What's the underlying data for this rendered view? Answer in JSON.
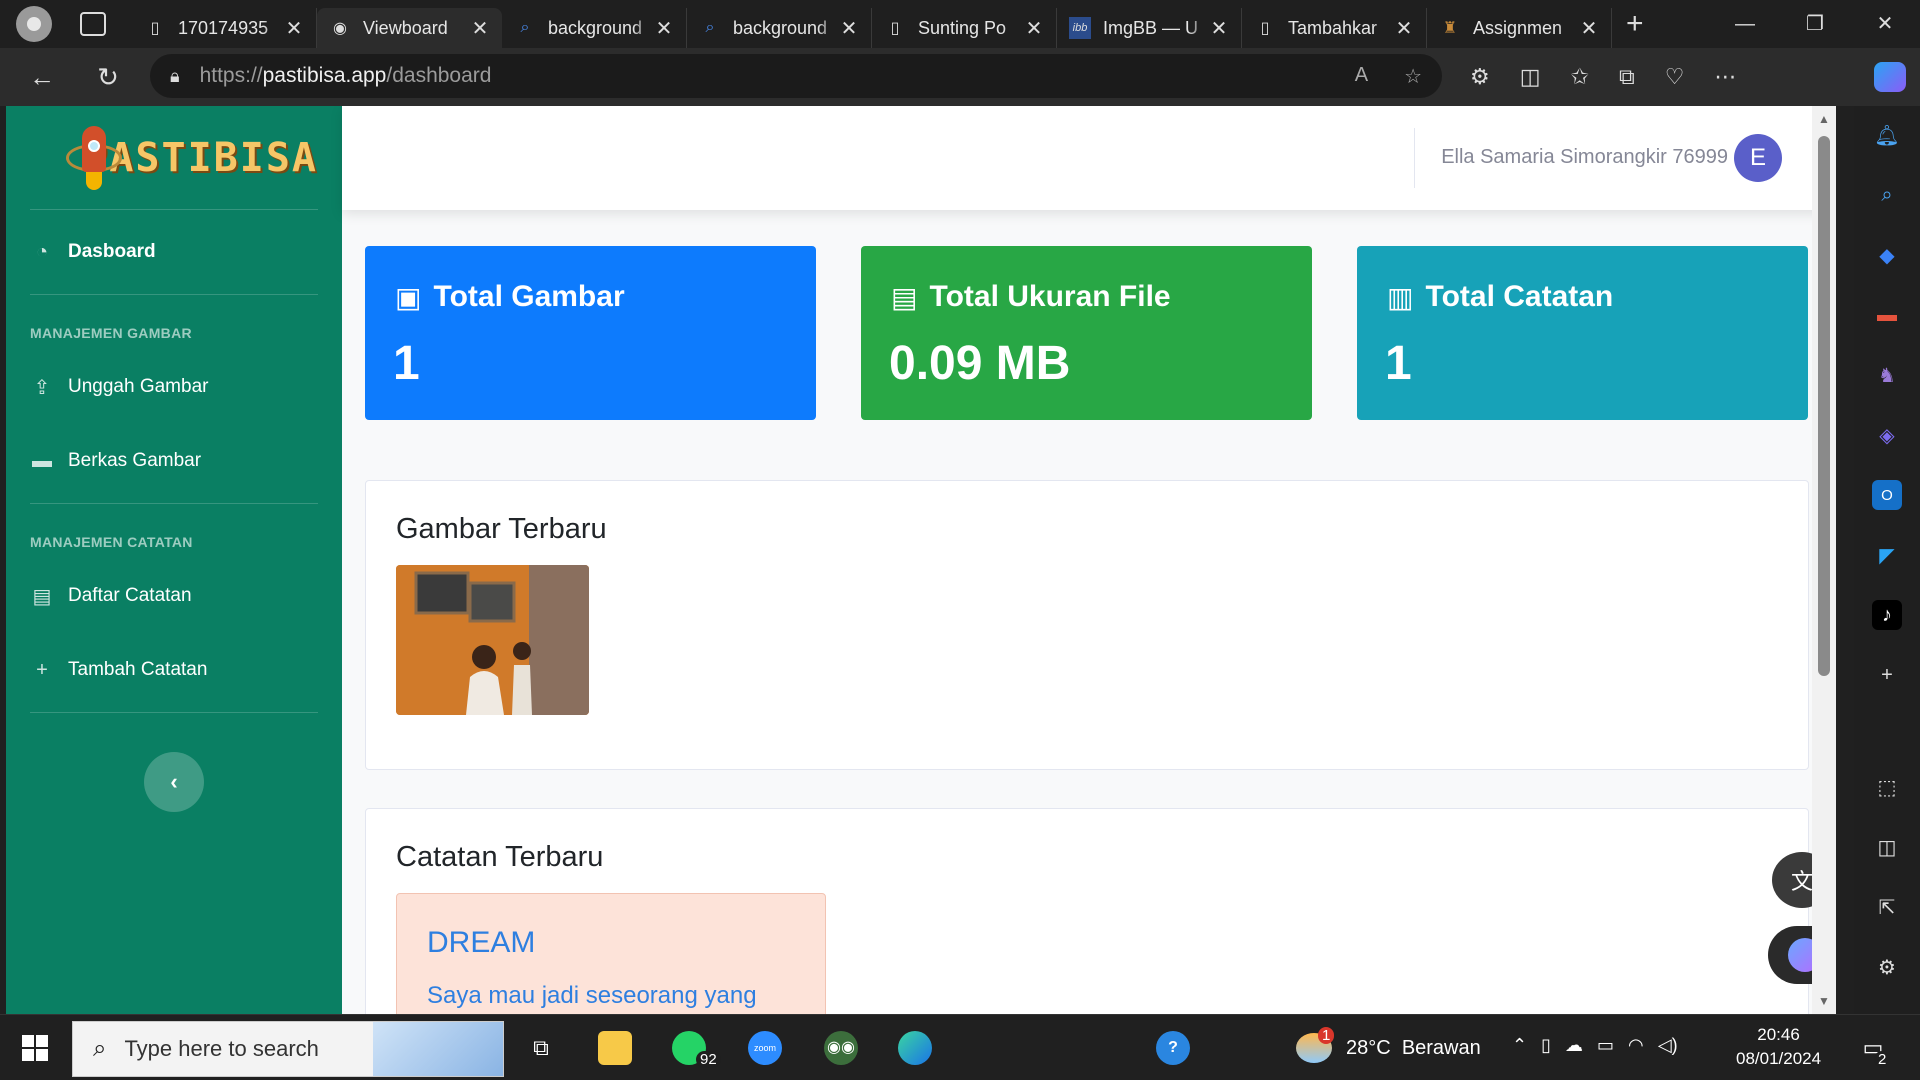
{
  "browser": {
    "tabs": [
      {
        "title": "170174935",
        "icon": "page-icon",
        "active": false
      },
      {
        "title": "Viewboard",
        "icon": "pastibisa-icon",
        "active": true
      },
      {
        "title": "background",
        "icon": "search-icon",
        "active": false
      },
      {
        "title": "background",
        "icon": "search-icon",
        "active": false
      },
      {
        "title": "Sunting Po",
        "icon": "page-icon",
        "active": false
      },
      {
        "title": "ImgBB — U",
        "icon": "imgbb-icon",
        "active": false
      },
      {
        "title": "Tambahkar",
        "icon": "page-icon",
        "active": false
      },
      {
        "title": "Assignmen",
        "icon": "assignment-icon",
        "active": false
      }
    ],
    "url_prefix": "https://",
    "url_host": "pastibisa.app",
    "url_path": "/dashboard"
  },
  "sidebar": {
    "brand": "PASTIBISA",
    "dashboard_label": "Dasboard",
    "section_gambar": "MANAJEMEN GAMBAR",
    "upload_label": "Unggah Gambar",
    "files_label": "Berkas Gambar",
    "section_catatan": "MANAJEMEN CATATAN",
    "list_label": "Daftar Catatan",
    "add_label": "Tambah Catatan",
    "collapse_glyph": "‹"
  },
  "topbar": {
    "username": "Ella Samaria Simorangkir 76999",
    "avatar_letter": "E"
  },
  "stats": {
    "images": {
      "title": "Total Gambar",
      "value": "1",
      "color": "#0d7bfd"
    },
    "size": {
      "title": "Total Ukuran File",
      "value": "0.09 MB",
      "color": "#28a745"
    },
    "notes": {
      "title": "Total Catatan",
      "value": "1",
      "color": "#17a2b8"
    }
  },
  "recent_images": {
    "title": "Gambar Terbaru"
  },
  "recent_notes": {
    "title": "Catatan Terbaru",
    "note_title": "DREAM",
    "note_body": "Saya mau jadi seseorang yang"
  },
  "taskbar": {
    "search_placeholder": "Type here to search",
    "whatsapp_badge": "92",
    "weather_temp": "28°C",
    "weather_text": "Berawan",
    "weather_badge": "1",
    "time": "20:46",
    "date": "08/01/2024",
    "notif_count": "2"
  }
}
